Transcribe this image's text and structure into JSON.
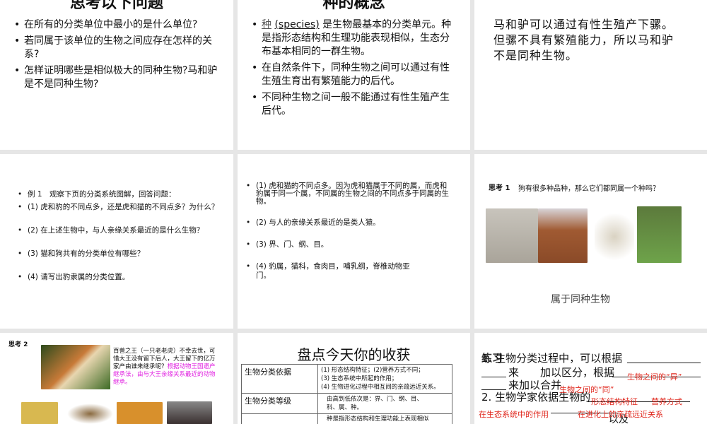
{
  "slides": {
    "s1": {
      "title": "思考以下问题",
      "items": [
        "在所有的分类单位中最小的是什么单位?",
        "若同属于该单位的生物之间应存在怎样的关系?",
        "怎样证明哪些是相似极大的同种生物?马和驴是不是同种生物?"
      ]
    },
    "s2": {
      "title": "种的概念",
      "item1_term": "种",
      "item1_species": "(species)",
      "item1_rest": " 是生物最基本的分类单元。种是指形态结构和生理功能表现相似，生态分布基本相同的一群生物。",
      "items": [
        "在自然条件下，同种生物之间可以通过有性生殖生育出有繁殖能力的后代。",
        "不同种生物之间一般不能通过有性生殖产生后代。"
      ]
    },
    "s3": {
      "text": "马和驴可以通过有性生殖产下骡。但骡不具有繁殖能力，所以马和驴不是同种生物。"
    },
    "s4": {
      "items": [
        "例 1　观察下页的分类系统图解，回答问题：",
        "(1) 虎和豹的不同点多，还是虎和猫的不同点多？为什么？",
        "(2) 在上述生物中，与人亲缘关系最近的是什么生物？",
        "(3) 猫和狗共有的分类单位有哪些？",
        "(4) 请写出豹隶属的分类位置。"
      ]
    },
    "s5": {
      "items": [
        "(1) 虎和猫的不同点多。因为虎和猫属于不同的属，而虎和豹属于同一个属，不同属的生物之间的不同点多于同属的生物。",
        "(2) 与人的亲缘关系最近的是类人猿。",
        "(3) 界、门、纲、目。",
        "(4) 豹属，猫科，食肉目，哺乳纲，脊椎动物亚门。"
      ]
    },
    "s6": {
      "label": "思考 1",
      "question": "狗有很多种品种，那么它们都同属一个种吗？",
      "answer": "属于同种生物"
    },
    "s7": {
      "label": "思考 2",
      "text_black": "百兽之王（一只老老虎）不幸去世，可惜大王没有留下后人，大王留下的亿万家产由谁来继承呢？",
      "text_magenta": "根据动物王国遗产继承法，由与大王亲缘关系最近的动物继承。"
    },
    "s8": {
      "title": "盘点今天你的收获",
      "rows": [
        {
          "head": "生物分类依据",
          "lines": [
            "(1) 形态结构特征；(2)营养方式不同；",
            "(3) 生态系统中所起的作用；",
            "(4) 生物进化过程中相互间的亲疏远近关系。"
          ]
        },
        {
          "head": "生物分类等级",
          "lines": [
            "由高到低依次是：界、门、纲、目、",
            "科、属、种。"
          ]
        },
        {
          "head": "",
          "lines": [
            "种是指形态结构和生理功能上表现相似"
          ]
        }
      ]
    },
    "s9": {
      "heading": "练习",
      "q1a": "1. 生物分类过程中，可以根据",
      "q1b": "来　　加以区分，根据",
      "q1c": "来加以合并",
      "q2": "2. 生物学家依据生物的",
      "q2end": "以及",
      "answers": [
        "生物之间的“异”",
        "生物之间的“同”",
        "形态结构特征",
        "营养方式",
        "在生态系统中的作用",
        "在进化上的亲疏远近关系"
      ]
    }
  },
  "colors": {
    "magenta": "#e020e0",
    "red": "#e0281e"
  }
}
